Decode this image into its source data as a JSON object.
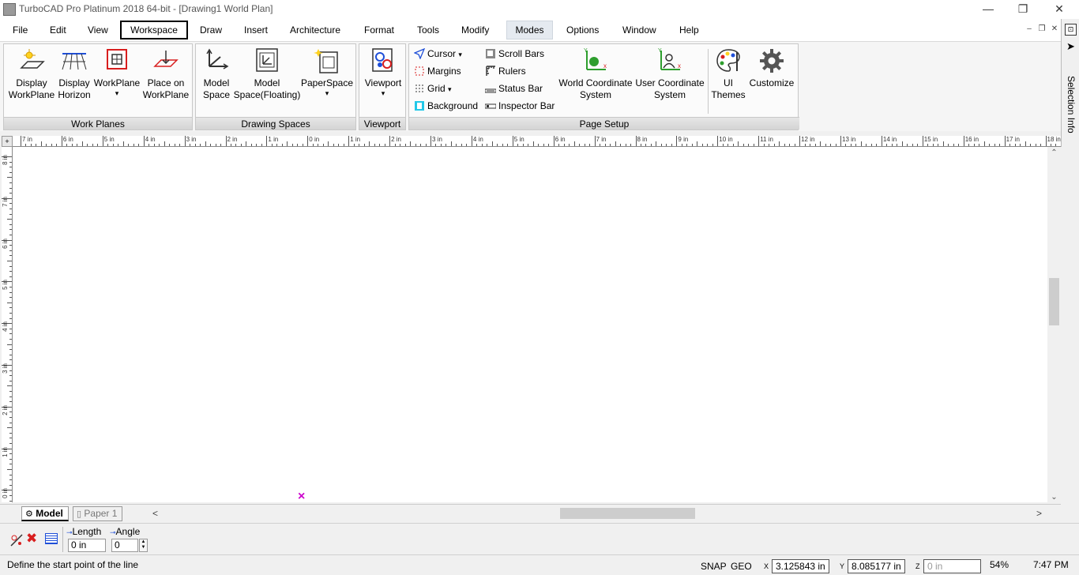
{
  "window": {
    "title": "TurboCAD Pro Platinum 2018 64-bit - [Drawing1 World Plan]",
    "controls": {
      "minimize": "—",
      "restore": "❐",
      "close": "✕"
    }
  },
  "menu": {
    "items": [
      "File",
      "Edit",
      "View",
      "Workspace",
      "Draw",
      "Insert",
      "Architecture",
      "Format",
      "Tools",
      "Modify",
      "Modes",
      "Options",
      "Window",
      "Help"
    ],
    "boxed": "Workspace",
    "active": "Modes",
    "mdi_controls": {
      "minimize": "–",
      "restore": "❐",
      "close": "✕"
    }
  },
  "ribbon": {
    "groups": {
      "work_planes": {
        "label": "Work Planes",
        "buttons": [
          "Display\nWorkPlane",
          "Display\nHorizon",
          "WorkPlane",
          "Place on\nWorkPlane"
        ]
      },
      "drawing_spaces": {
        "label": "Drawing Spaces",
        "buttons": [
          "Model\nSpace",
          "Model\nSpace(Floating)",
          "PaperSpace"
        ]
      },
      "viewport": {
        "label": "Viewport",
        "buttons": [
          "Viewport"
        ]
      },
      "page_setup": {
        "label": "Page Setup",
        "small_left": [
          "Cursor",
          "Margins",
          "Grid",
          "Background"
        ],
        "small_mid": [
          "Scroll Bars",
          "Rulers",
          "Status Bar",
          "Inspector Bar"
        ],
        "big": [
          "World Coordinate\nSystem",
          "User Coordinate\nSystem"
        ]
      },
      "themes": {
        "buttons": [
          "UI\nThemes",
          "Customize"
        ]
      }
    },
    "dropdown_arrow": "▾"
  },
  "side_panel": {
    "label": "Selection Info"
  },
  "rulers": {
    "horizontal": [
      "7 in",
      "6 in",
      "5 in",
      "4 in",
      "3 in",
      "2 in",
      "1 in",
      "0 in",
      "1 in",
      "2 in",
      "3 in",
      "4 in",
      "5 in",
      "6 in",
      "7 in",
      "8 in",
      "9 in",
      "10 in",
      "11 in",
      "12 in",
      "13 in",
      "14 in",
      "15 in",
      "16 in",
      "17 in",
      "18 in"
    ],
    "vertical": [
      "8 in",
      "7 in",
      "6 in",
      "5 in",
      "4 in",
      "3 in",
      "2 in",
      "1 in",
      "0 in"
    ]
  },
  "canvas": {
    "cursor_marker": "×"
  },
  "scrollbars": {
    "up": "⌃",
    "down": "⌄",
    "left": "<",
    "right": ">"
  },
  "tabs": [
    {
      "label": "Model",
      "active": true
    },
    {
      "label": "Paper 1",
      "active": false
    }
  ],
  "inspector": {
    "length_label": "Length",
    "angle_label": "Angle",
    "length_value": "0 in",
    "angle_value": "0"
  },
  "status": {
    "prompt": "Define the start point of the line",
    "snap": "SNAP",
    "geo": "GEO",
    "x_label": "X",
    "y_label": "Y",
    "z_label": "Z",
    "x_value": "3.125843 in",
    "y_value": "8.085177 in",
    "z_placeholder": "0 in",
    "zoom": "54%",
    "time": "7:47 PM"
  },
  "colors": {
    "accent_blue": "#1f4fd8",
    "marker_magenta": "#cc00cc",
    "icon_red": "#d81e1e",
    "icon_green": "#2e9e2e"
  }
}
